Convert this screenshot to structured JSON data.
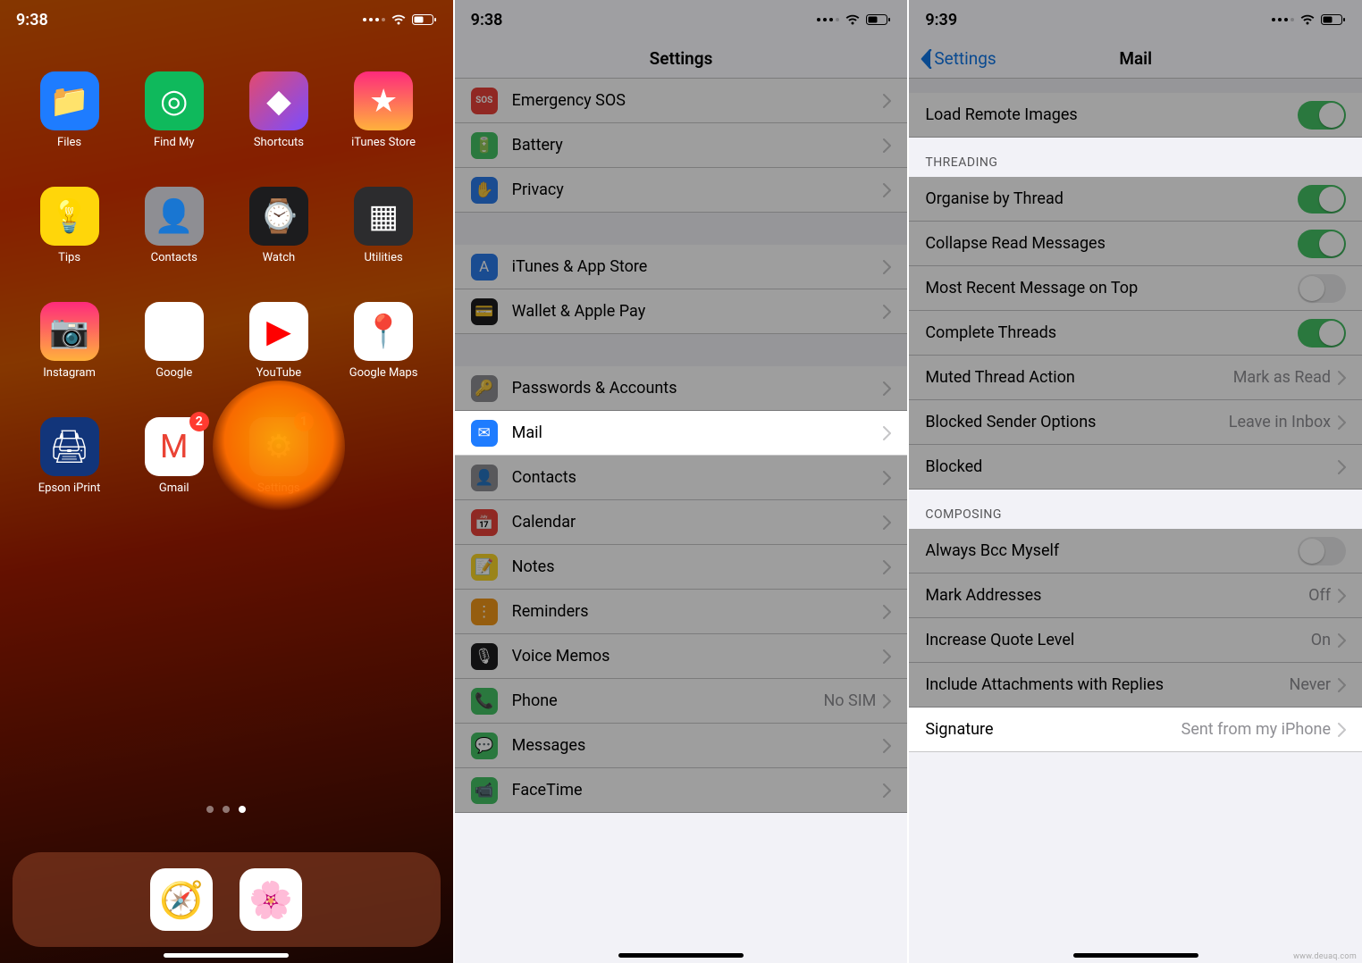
{
  "watermark": "www.deuaq.com",
  "phone1": {
    "status": {
      "time": "9:38"
    },
    "apps": [
      {
        "name": "Files",
        "color": "bg-blue",
        "glyph": "📁"
      },
      {
        "name": "Find My",
        "color": "bg-green",
        "glyph": "◎"
      },
      {
        "name": "Shortcuts",
        "color": "bg-grad",
        "glyph": "◆"
      },
      {
        "name": "iTunes Store",
        "color": "bg-pink",
        "glyph": "★"
      },
      {
        "name": "Tips",
        "color": "bg-yellow",
        "glyph": "💡"
      },
      {
        "name": "Contacts",
        "color": "bg-grey",
        "glyph": "👤"
      },
      {
        "name": "Watch",
        "color": "bg-black",
        "glyph": "⌚"
      },
      {
        "name": "Utilities",
        "color": "bg-dark",
        "glyph": "▦"
      },
      {
        "name": "Instagram",
        "color": "bg-pink",
        "glyph": "📷"
      },
      {
        "name": "Google",
        "color": "bg-white",
        "glyph": "G"
      },
      {
        "name": "YouTube",
        "color": "bg-white",
        "glyph": "▶",
        "text_color": "#ff0000"
      },
      {
        "name": "Google Maps",
        "color": "bg-white",
        "glyph": "📍"
      },
      {
        "name": "Epson iPrint",
        "color": "bg-epson",
        "glyph": "🖨"
      },
      {
        "name": "Gmail",
        "color": "bg-white",
        "glyph": "M",
        "badge": "2",
        "text_color": "#ea4335"
      },
      {
        "name": "Settings",
        "color": "bg-grey",
        "glyph": "⚙",
        "badge": "1",
        "highlight": true
      }
    ],
    "dock": [
      {
        "name": "Safari",
        "color": "bg-white",
        "glyph": "🧭"
      },
      {
        "name": "Photos",
        "color": "bg-white",
        "glyph": "🌸"
      }
    ]
  },
  "phone2": {
    "status": {
      "time": "9:38"
    },
    "title": "Settings",
    "rows": [
      {
        "icon": "SOS",
        "icon_bg": "#ff3b30",
        "label": "Emergency SOS"
      },
      {
        "icon": "🔋",
        "icon_bg": "#34c759",
        "label": "Battery"
      },
      {
        "icon": "✋",
        "icon_bg": "#1e7cff",
        "label": "Privacy"
      },
      {
        "gap": true
      },
      {
        "icon": "A",
        "icon_bg": "#1e7cff",
        "label": "iTunes & App Store"
      },
      {
        "icon": "💳",
        "icon_bg": "#1c1c1e",
        "label": "Wallet & Apple Pay"
      },
      {
        "gap": true
      },
      {
        "icon": "🔑",
        "icon_bg": "#8e8e93",
        "label": "Passwords & Accounts"
      },
      {
        "icon": "✉",
        "icon_bg": "#1e7cff",
        "label": "Mail",
        "highlight": true
      },
      {
        "icon": "👤",
        "icon_bg": "#8e8e93",
        "label": "Contacts"
      },
      {
        "icon": "📅",
        "icon_bg": "#ff3b30",
        "label": "Calendar"
      },
      {
        "icon": "📝",
        "icon_bg": "#ffd60a",
        "label": "Notes"
      },
      {
        "icon": "⋮",
        "icon_bg": "#ff9500",
        "label": "Reminders"
      },
      {
        "icon": "🎙",
        "icon_bg": "#1c1c1e",
        "label": "Voice Memos"
      },
      {
        "icon": "📞",
        "icon_bg": "#34c759",
        "label": "Phone",
        "detail": "No SIM"
      },
      {
        "icon": "💬",
        "icon_bg": "#34c759",
        "label": "Messages"
      },
      {
        "icon": "📹",
        "icon_bg": "#34c759",
        "label": "FaceTime"
      }
    ]
  },
  "phone3": {
    "status": {
      "time": "9:39"
    },
    "back": "Settings",
    "title": "Mail",
    "groups": [
      {
        "header": null,
        "rows": [
          {
            "label": "Load Remote Images",
            "toggle": "on"
          }
        ]
      },
      {
        "header": "THREADING",
        "rows": [
          {
            "label": "Organise by Thread",
            "toggle": "on"
          },
          {
            "label": "Collapse Read Messages",
            "toggle": "on"
          },
          {
            "label": "Most Recent Message on Top",
            "toggle": "off"
          },
          {
            "label": "Complete Threads",
            "toggle": "on"
          },
          {
            "label": "Muted Thread Action",
            "detail": "Mark as Read",
            "chev": true
          },
          {
            "label": "Blocked Sender Options",
            "detail": "Leave in Inbox",
            "chev": true
          },
          {
            "label": "Blocked",
            "chev": true
          }
        ]
      },
      {
        "header": "COMPOSING",
        "rows": [
          {
            "label": "Always Bcc Myself",
            "toggle": "off"
          },
          {
            "label": "Mark Addresses",
            "detail": "Off",
            "chev": true
          },
          {
            "label": "Increase Quote Level",
            "detail": "On",
            "chev": true
          },
          {
            "label": "Include Attachments with Replies",
            "detail": "Never",
            "chev": true
          },
          {
            "label": "Signature",
            "detail": "Sent from my iPhone",
            "chev": true,
            "highlight": true
          }
        ]
      }
    ]
  }
}
